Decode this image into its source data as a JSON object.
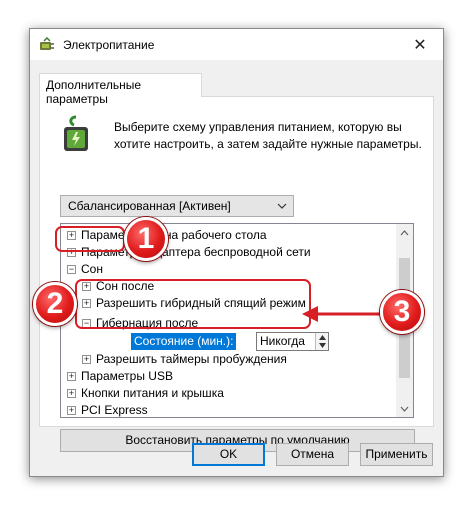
{
  "window": {
    "title": "Электропитание",
    "close_glyph": "✕",
    "icon": "power-options-icon"
  },
  "tab": {
    "label": "Дополнительные параметры"
  },
  "description": "Выберите схему управления питанием, которую вы хотите настроить, а затем задайте нужные параметры.",
  "scheme_select": {
    "value": "Сбалансированная [Активен]"
  },
  "tree": {
    "items": [
      {
        "label": "Параметры фона рабочего стола",
        "expander": "+"
      },
      {
        "label": "Параметры адаптера беспроводной сети",
        "expander": "+"
      },
      {
        "label": "Сон",
        "expander": "−"
      },
      {
        "label": "Сон после",
        "expander": "+"
      },
      {
        "label": "Разрешить гибридный спящий режим",
        "expander": "+"
      },
      {
        "label": "Гибернация после",
        "expander": "−"
      },
      {
        "label": "Состояние (мин.):",
        "value": "Никогда"
      },
      {
        "label": "Разрешить таймеры пробуждения",
        "expander": "+"
      },
      {
        "label": "Параметры USB",
        "expander": "+"
      },
      {
        "label": "Кнопки питания и крышка",
        "expander": "+"
      },
      {
        "label": "PCI Express",
        "expander": "+"
      }
    ]
  },
  "restore_button": {
    "label": "Восстановить параметры по умолчанию"
  },
  "buttons": {
    "ok": "OK",
    "cancel": "Отмена",
    "apply": "Применить"
  },
  "callouts": [
    "1",
    "2",
    "3"
  ],
  "colors": {
    "accent": "#0078d7",
    "callout_red": "#d61f26"
  }
}
